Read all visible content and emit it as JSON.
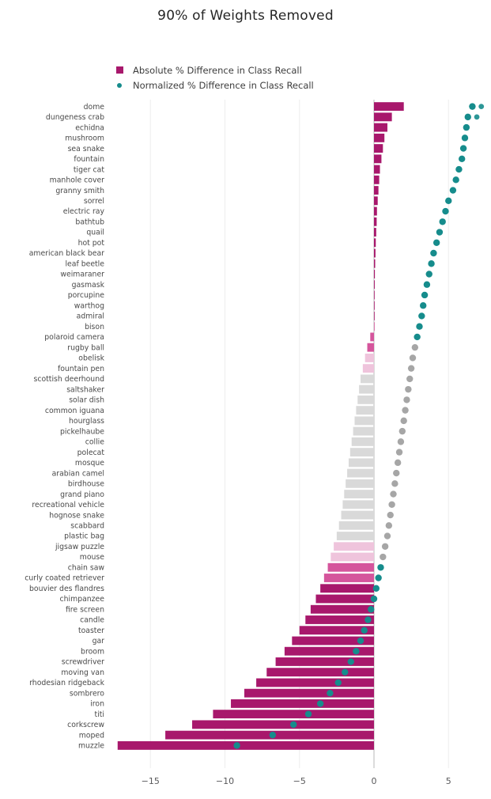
{
  "chart_data": {
    "type": "bar",
    "title": "90% of Weights Removed",
    "xlabel": "",
    "ylabel": "",
    "orientation": "horizontal",
    "grid": true,
    "legend_position": "top-left",
    "xlim": [
      -17.8,
      7.6
    ],
    "xticks": [
      -15,
      -10,
      -5,
      0,
      5
    ],
    "xticklabels": [
      "−15",
      "−10",
      "−5",
      "0",
      "5"
    ],
    "colors": {
      "absolute_significant": "#A8186C",
      "absolute_midtone": "#D5559C",
      "absolute_light": "#EFC4DC",
      "neutral_gray": "#D9D9D9",
      "normalized_significant": "#168C8C",
      "normalized_gray": "#A6A6A6",
      "gridline": "#EDEDED",
      "zeroline": "#BFBFBF",
      "text": "#4a4a4a"
    },
    "series": [
      {
        "name": "Absolute % Difference in Class Recall",
        "key": "absolute",
        "type": "bar"
      },
      {
        "name": "Normalized % Difference in Class Recall",
        "key": "normalized",
        "type": "scatter"
      }
    ],
    "categories": [
      "dome",
      "dungeness crab",
      "echidna",
      "mushroom",
      "sea snake",
      "fountain",
      "tiger cat",
      "manhole cover",
      "granny smith",
      "sorrel",
      "electric ray",
      "bathtub",
      "quail",
      "hot pot",
      "american black bear",
      "leaf beetle",
      "weimaraner",
      "gasmask",
      "porcupine",
      "warthog",
      "admiral",
      "bison",
      "polaroid camera",
      "rugby ball",
      "obelisk",
      "fountain pen",
      "scottish deerhound",
      "saltshaker",
      "solar dish",
      "common iguana",
      "hourglass",
      "pickelhaube",
      "collie",
      "polecat",
      "mosque",
      "arabian camel",
      "birdhouse",
      "grand piano",
      "recreational vehicle",
      "hognose snake",
      "scabbard",
      "plastic bag",
      "jigsaw puzzle",
      "mouse",
      "chain saw",
      "curly coated retriever",
      "bouvier des flandres",
      "chimpanzee",
      "fire screen",
      "candle",
      "toaster",
      "gar",
      "broom",
      "screwdriver",
      "moving van",
      "rhodesian ridgeback",
      "sombrero",
      "iron",
      "titi",
      "corkscrew",
      "moped",
      "muzzle"
    ],
    "absolute_values": [
      2.0,
      1.2,
      0.9,
      0.7,
      0.6,
      0.5,
      0.4,
      0.35,
      0.3,
      0.25,
      0.2,
      0.18,
      0.15,
      0.12,
      0.1,
      0.08,
      0.06,
      0.05,
      0.04,
      0.03,
      0.02,
      0.0,
      -0.25,
      -0.45,
      -0.6,
      -0.75,
      -0.9,
      -1.0,
      -1.1,
      -1.2,
      -1.3,
      -1.4,
      -1.5,
      -1.6,
      -1.7,
      -1.8,
      -1.9,
      -2.0,
      -2.1,
      -2.2,
      -2.35,
      -2.5,
      -2.7,
      -2.9,
      -3.1,
      -3.35,
      -3.6,
      -3.9,
      -4.25,
      -4.6,
      -5.0,
      -5.5,
      -6.0,
      -6.6,
      -7.2,
      -7.9,
      -8.7,
      -9.6,
      -10.8,
      -12.2,
      -14.0,
      -17.2
    ],
    "normalized_values": [
      6.6,
      6.3,
      6.2,
      6.1,
      6.0,
      5.9,
      5.7,
      5.5,
      5.3,
      5.0,
      4.8,
      4.6,
      4.4,
      4.2,
      4.0,
      3.85,
      3.7,
      3.55,
      3.4,
      3.3,
      3.2,
      3.05,
      2.9,
      2.75,
      2.6,
      2.5,
      2.4,
      2.3,
      2.2,
      2.1,
      2.0,
      1.9,
      1.8,
      1.7,
      1.6,
      1.5,
      1.4,
      1.3,
      1.2,
      1.1,
      1.0,
      0.9,
      0.75,
      0.6,
      0.45,
      0.3,
      0.15,
      0.0,
      -0.2,
      -0.4,
      -0.65,
      -0.9,
      -1.2,
      -1.55,
      -1.95,
      -2.4,
      -2.95,
      -3.6,
      -4.4,
      -5.4,
      -6.8,
      -9.2
    ],
    "absolute_styles": [
      "sig",
      "sig",
      "sig",
      "sig",
      "sig",
      "sig",
      "sig",
      "sig",
      "sig",
      "sig",
      "sig",
      "sig",
      "sig",
      "sig",
      "sig",
      "sig",
      "sig",
      "sig",
      "sig",
      "sig",
      "sig",
      "mid",
      "mid",
      "mid",
      "light",
      "light",
      "gray",
      "gray",
      "gray",
      "gray",
      "gray",
      "gray",
      "gray",
      "gray",
      "gray",
      "gray",
      "gray",
      "gray",
      "gray",
      "gray",
      "gray",
      "gray",
      "light",
      "light",
      "mid",
      "mid",
      "sig",
      "sig",
      "sig",
      "sig",
      "sig",
      "sig",
      "sig",
      "sig",
      "sig",
      "sig",
      "sig",
      "sig",
      "sig",
      "sig",
      "sig",
      "sig"
    ],
    "normalized_styles": [
      "sig",
      "sig",
      "sig",
      "sig",
      "sig",
      "sig",
      "sig",
      "sig",
      "sig",
      "sig",
      "sig",
      "sig",
      "sig",
      "sig",
      "sig",
      "sig",
      "sig",
      "sig",
      "sig",
      "sig",
      "sig",
      "sig",
      "sig",
      "gray",
      "gray",
      "gray",
      "gray",
      "gray",
      "gray",
      "gray",
      "gray",
      "gray",
      "gray",
      "gray",
      "gray",
      "gray",
      "gray",
      "gray",
      "gray",
      "gray",
      "gray",
      "gray",
      "gray",
      "gray",
      "sig",
      "sig",
      "sig",
      "sig",
      "sig",
      "sig",
      "sig",
      "sig",
      "sig",
      "sig",
      "sig",
      "sig",
      "sig",
      "sig",
      "sig",
      "sig",
      "sig",
      "sig"
    ],
    "outlier_dots": [
      {
        "x": 7.2,
        "row": 0
      },
      {
        "x": 6.9,
        "row": 1
      }
    ]
  },
  "legend": {
    "items": [
      {
        "label": "Absolute % Difference in Class Recall",
        "marker": "square-icon"
      },
      {
        "label": "Normalized % Difference in Class Recall",
        "marker": "dot-icon"
      }
    ]
  }
}
